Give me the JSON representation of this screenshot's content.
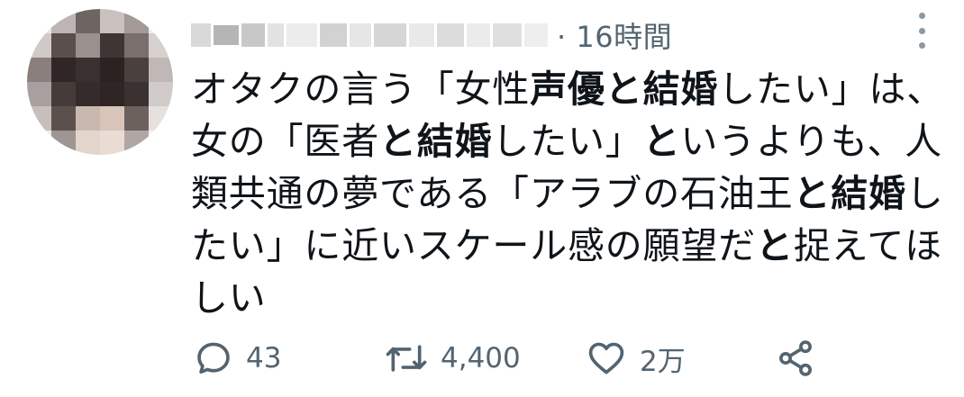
{
  "tweet": {
    "time": "· 16時間",
    "text_parts": [
      "オタクの言う「女性",
      "声優と結婚",
      "したい」は、",
      "女の「医者",
      "と結婚",
      "したい」",
      "と",
      "いうよりも、人",
      "類共通の夢である「アラブの石油王",
      "と結婚",
      "し",
      "たい」に近いスケール感の願望だ",
      "と",
      "捉えてほ",
      "しい"
    ]
  },
  "actions": {
    "reply_count": "43",
    "retweet_count": "4,400",
    "like_count": "2万"
  },
  "icons": {
    "reply": "reply-icon",
    "retweet": "retweet-icon",
    "like": "heart-icon",
    "share": "share-icon",
    "more": "more-options-icon"
  },
  "colors": {
    "text": "#0f1419",
    "muted": "#536471"
  }
}
